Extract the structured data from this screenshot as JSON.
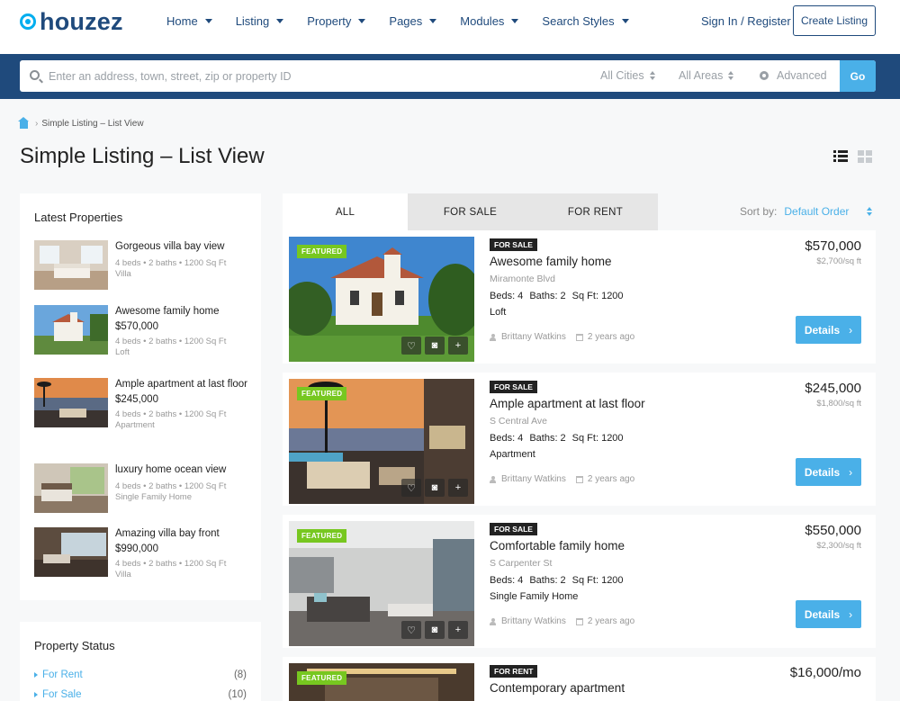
{
  "header": {
    "logo": "houzez",
    "nav": [
      "Home",
      "Listing",
      "Property",
      "Pages",
      "Modules",
      "Search Styles"
    ],
    "signin": "Sign In / Register",
    "create_listing": "Create Listing"
  },
  "search": {
    "placeholder": "Enter an address, town, street, zip or property ID",
    "cities": "All Cities",
    "areas": "All Areas",
    "advanced": "Advanced",
    "go": "Go"
  },
  "breadcrumb": {
    "current": "Simple Listing – List View"
  },
  "page_title": "Simple Listing – List View",
  "sidebar": {
    "latest_title": "Latest Properties",
    "latest": [
      {
        "title": "Gorgeous villa bay view",
        "price": "",
        "meta": "4 beds • 2 baths • 1200 Sq Ft",
        "type": "Villa"
      },
      {
        "title": "Awesome family home",
        "price": "$570,000",
        "meta": "4 beds • 2 baths • 1200 Sq Ft",
        "type": "Loft"
      },
      {
        "title": "Ample apartment at last floor",
        "price": "$245,000",
        "meta": "4 beds • 2 baths • 1200 Sq Ft",
        "type": "Apartment"
      },
      {
        "title": "luxury home ocean view",
        "price": "",
        "meta": "4 beds • 2 baths • 1200 Sq Ft",
        "type": "Single Family Home"
      },
      {
        "title": "Amazing villa bay front",
        "price": "$990,000",
        "meta": "4 beds • 2 baths • 1200 Sq Ft",
        "type": "Villa"
      }
    ],
    "status_title": "Property Status",
    "status": [
      {
        "label": "For Rent",
        "count": "(8)"
      },
      {
        "label": "For Sale",
        "count": "(10)"
      }
    ]
  },
  "tabs": [
    "ALL",
    "FOR SALE",
    "FOR RENT"
  ],
  "sort": {
    "label": "Sort by:",
    "value": "Default Order"
  },
  "listings": [
    {
      "featured": "FEATURED",
      "status": "FOR SALE",
      "title": "Awesome family home",
      "address": "Miramonte Blvd",
      "beds": "Beds: 4",
      "baths": "Baths: 2",
      "sqft": "Sq Ft: 1200",
      "type": "Loft",
      "agent": "Brittany Watkins",
      "date": "2 years ago",
      "price": "$570,000",
      "price_sqft": "$2,700/sq ft",
      "details": "Details"
    },
    {
      "featured": "FEATURED",
      "status": "FOR SALE",
      "title": "Ample apartment at last floor",
      "address": "S Central Ave",
      "beds": "Beds: 4",
      "baths": "Baths: 2",
      "sqft": "Sq Ft: 1200",
      "type": "Apartment",
      "agent": "Brittany Watkins",
      "date": "2 years ago",
      "price": "$245,000",
      "price_sqft": "$1,800/sq ft",
      "details": "Details"
    },
    {
      "featured": "FEATURED",
      "status": "FOR SALE",
      "title": "Comfortable family home",
      "address": "S Carpenter St",
      "beds": "Beds: 4",
      "baths": "Baths: 2",
      "sqft": "Sq Ft: 1200",
      "type": "Single Family Home",
      "agent": "Brittany Watkins",
      "date": "2 years ago",
      "price": "$550,000",
      "price_sqft": "$2,300/sq ft",
      "details": "Details"
    },
    {
      "featured": "FEATURED",
      "status": "FOR RENT",
      "title": "Contemporary apartment",
      "price": "$16,000/mo"
    }
  ],
  "colors": {
    "brand": "#1f4a7c",
    "accent": "#4ab0e8",
    "featured": "#77c720"
  }
}
